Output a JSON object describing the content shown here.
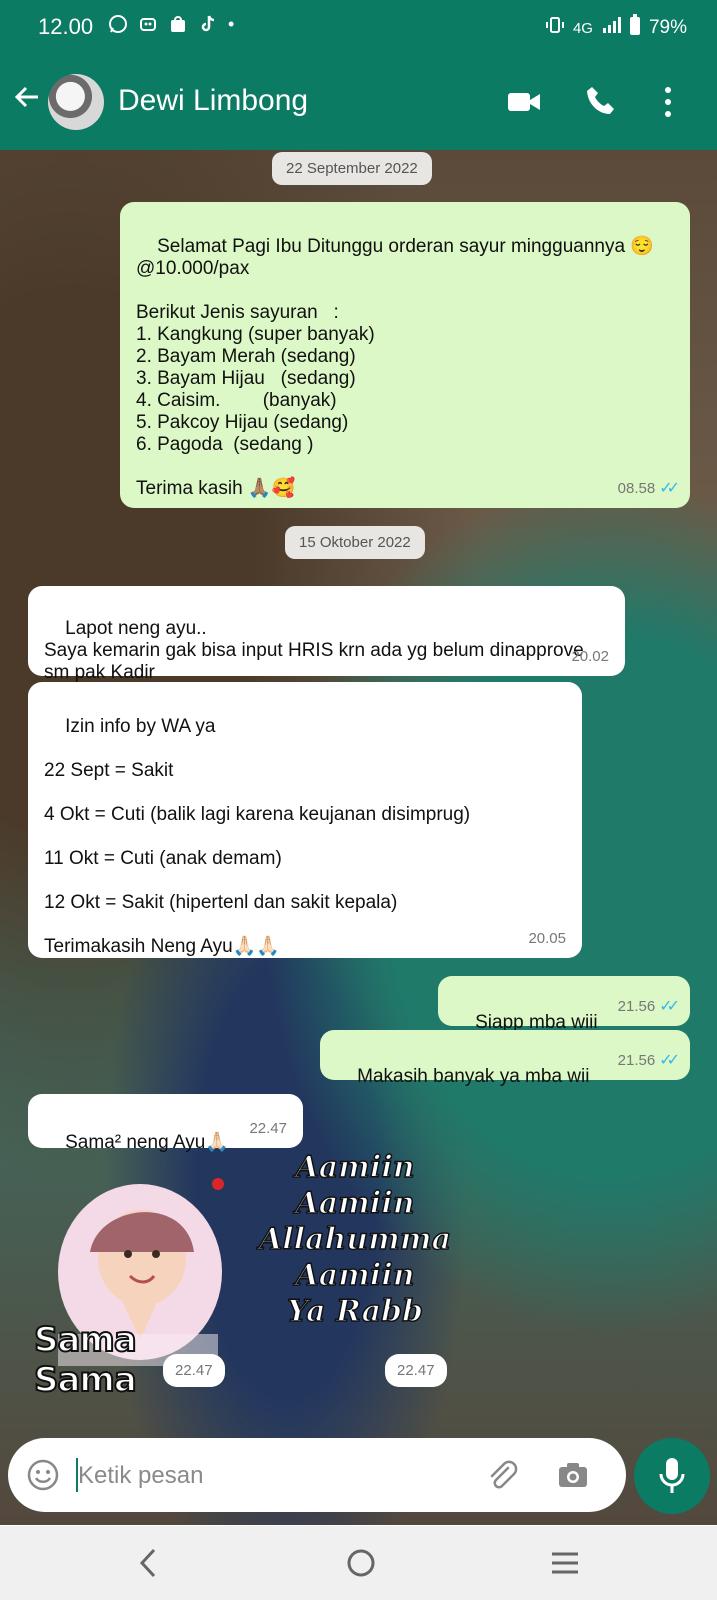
{
  "status": {
    "time": "12.00",
    "battery": "79%",
    "network": "4G",
    "notification_icons": [
      "whatsapp-icon",
      "bot-icon",
      "shop-icon",
      "tiktok-icon",
      "dot-icon"
    ]
  },
  "header": {
    "contact_name": "Dewi Limbong"
  },
  "dates": [
    "22 September 2022",
    "15 Oktober 2022"
  ],
  "messages": [
    {
      "text": "Selamat Pagi Ibu Ditunggu orderan sayur mingguannya 😌\n@10.000/pax\n\nBerikut Jenis sayuran   :\n1. Kangkung (super banyak)\n2. Bayam Merah (sedang)\n3. Bayam Hijau   (sedang)\n4. Caisim.        (banyak)\n5. Pakcoy Hijau (sedang)\n6. Pagoda  (sedang )\n\nTerima kasih 🙏🏽🥰",
      "time": "08.58",
      "read": true
    },
    {
      "text": "Lapot neng ayu..\nSaya kemarin gak bisa input HRIS krn ada yg belum dinapprove sm pak Kadir",
      "time": "20.02"
    },
    {
      "text": "Izin info by WA ya\n\n22 Sept = Sakit\n\n4 Okt = Cuti (balik lagi karena keujanan disimprug)\n\n11 Okt = Cuti (anak demam)\n\n12 Okt = Sakit (hipertenl dan sakit kepala)\n\nTerimakasih Neng Ayu🙏🏻🙏🏻",
      "time": "20.05"
    },
    {
      "text": "Siapp mba wiii",
      "time": "21.56",
      "read": true
    },
    {
      "text": "Makasih banyak ya mba wii",
      "time": "21.56",
      "read": true
    },
    {
      "text": "Sama² neng Ayu🙏🏻",
      "time": "22.47"
    }
  ],
  "stickers": [
    {
      "text": "Sama Sama",
      "time": "22.47"
    },
    {
      "lines": [
        "Aamiin",
        "Aamiin",
        "Allahumma",
        "Aamiin",
        "Ya Rabb"
      ],
      "time": "22.47"
    }
  ],
  "composer": {
    "placeholder": "Ketik pesan"
  },
  "colors": {
    "header": "#0b7b63",
    "outgoing": "#dcf8c6",
    "incoming": "#ffffff",
    "tick": "#34b7f1"
  }
}
